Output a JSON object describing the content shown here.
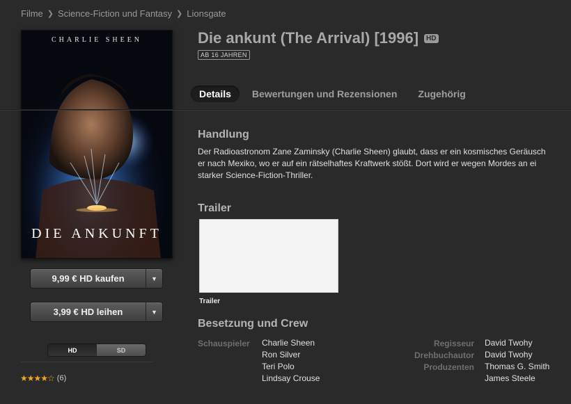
{
  "breadcrumb": [
    "Filme",
    "Science-Fiction und Fantasy",
    "Lionsgate"
  ],
  "poster": {
    "actor": "CHARLIE SHEEN",
    "title": "DIE ANKUNFT"
  },
  "purchase": {
    "buy_label": "9,99 € HD kaufen",
    "rent_label": "3,99 € HD leihen"
  },
  "format_toggle": {
    "hd": "HD",
    "sd": "SD",
    "selected": "HD"
  },
  "rating": {
    "stars": "★★★★☆",
    "count": "(6)",
    "value": 4
  },
  "movie": {
    "title": "Die ankunt (The Arrival) [1996]",
    "hd_badge": "HD",
    "age_rating": "AB 16 JAHREN"
  },
  "tabs": [
    "Details",
    "Bewertungen und Rezensionen",
    "Zugehörig"
  ],
  "sections": {
    "plot_heading": "Handlung",
    "plot_lines": [
      "Der Radioastronom Zane Zaminsky (Charlie Sheen) glaubt, dass er ein kosmisches Geräusch",
      "er nach Mexiko, wo er auf ein rätselhaftes Kraftwerk stößt. Dort wird er wegen Mordes an ei",
      "starker Science-Fiction-Thriller."
    ],
    "trailer_heading": "Trailer",
    "trailer_caption": "Trailer",
    "cast_heading": "Besetzung und Crew"
  },
  "cast": {
    "actors_label": "Schauspieler",
    "actors": [
      "Charlie Sheen",
      "Ron Silver",
      "Teri Polo",
      "Lindsay Crouse"
    ],
    "director_label": "Regisseur",
    "director": "David Twohy",
    "writer_label": "Drehbuchautor",
    "writer": "David Twohy",
    "producers_label": "Produzenten",
    "producers": [
      "Thomas G. Smith",
      "James Steele"
    ]
  },
  "colors": {
    "background": "#2a2a2a",
    "star": "#f2a722",
    "heading": "#b4b4b4"
  }
}
